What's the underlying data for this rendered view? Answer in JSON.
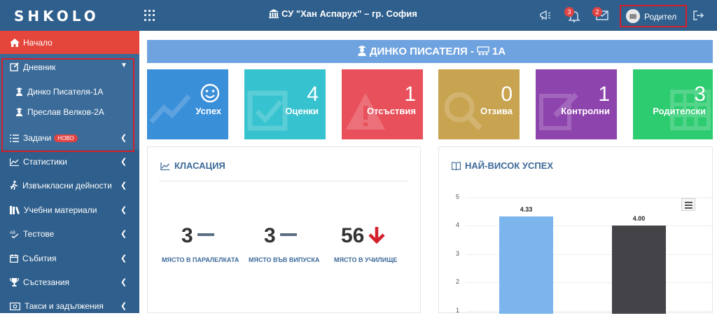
{
  "topbar": {
    "logo": "SHKOLO",
    "school": "СУ \"Хан Аспарух\" – гр. София",
    "notifications_count": "3",
    "messages_count": "2",
    "role": "Родител",
    "colors": {
      "bar": "#2f5f8c",
      "badge": "#e04343",
      "highlight": "#d3202a"
    }
  },
  "sidebar": {
    "home": "Начало",
    "diary": {
      "label": "Дневник",
      "children": [
        "Динко Писателя-1А",
        "Преслав Велков-2А"
      ]
    },
    "items": [
      {
        "label": "Задачи",
        "badge": "НОВО",
        "icon": "tasks-icon"
      },
      {
        "label": "Статистики",
        "icon": "chart-line-icon"
      },
      {
        "label": "Извънкласни дейности",
        "icon": "running-icon"
      },
      {
        "label": "Учебни материали",
        "icon": "books-icon"
      },
      {
        "label": "Тестове",
        "icon": "spellcheck-icon"
      },
      {
        "label": "Събития",
        "icon": "calendar-icon"
      },
      {
        "label": "Състезания",
        "icon": "trophy-icon"
      },
      {
        "label": "Такси и задължения",
        "icon": "money-icon"
      }
    ]
  },
  "banner": {
    "student": "ДИНКО ПИСАТЕЛЯ -",
    "class": "1А"
  },
  "tiles": [
    {
      "label": "Успех",
      "value": "",
      "icon": "smile-icon",
      "color": "#3a8fd9"
    },
    {
      "label": "Оценки",
      "value": "4",
      "icon": "check-icon",
      "color": "#36c2cf"
    },
    {
      "label": "Отсъствия",
      "value": "1",
      "icon": "warning-icon",
      "color": "#e8505b"
    },
    {
      "label": "Отзива",
      "value": "0",
      "icon": "search-icon",
      "color": "#c8a451"
    },
    {
      "label": "Контролни",
      "value": "1",
      "icon": "edit-icon",
      "color": "#8e44ad"
    },
    {
      "label": "Родителски",
      "value": "3",
      "icon": "table-icon",
      "color": "#2ecc71"
    }
  ],
  "ranking": {
    "title": "КЛАСАЦИЯ",
    "items": [
      {
        "value": "3",
        "label": "МЯСТО В ПАРАЛЕЛКАТА",
        "trend": "same"
      },
      {
        "value": "3",
        "label": "МЯСТО ВЪВ ВИПУСКА",
        "trend": "same"
      },
      {
        "value": "56",
        "label": "МЯСТО В УЧИЛИЩЕ",
        "trend": "down"
      }
    ]
  },
  "best": {
    "title": "НАЙ-ВИСОК УСПЕХ"
  },
  "chart_data": {
    "type": "bar",
    "categories": [
      "",
      ""
    ],
    "values": [
      4.33,
      4.0
    ],
    "value_labels": [
      "4.33",
      "4.00"
    ],
    "colors": [
      "#7cb5ec",
      "#434348"
    ],
    "yticks": [
      "5",
      "4",
      "3",
      "2",
      "1"
    ],
    "ylim": [
      0,
      5
    ],
    "grid": true
  }
}
